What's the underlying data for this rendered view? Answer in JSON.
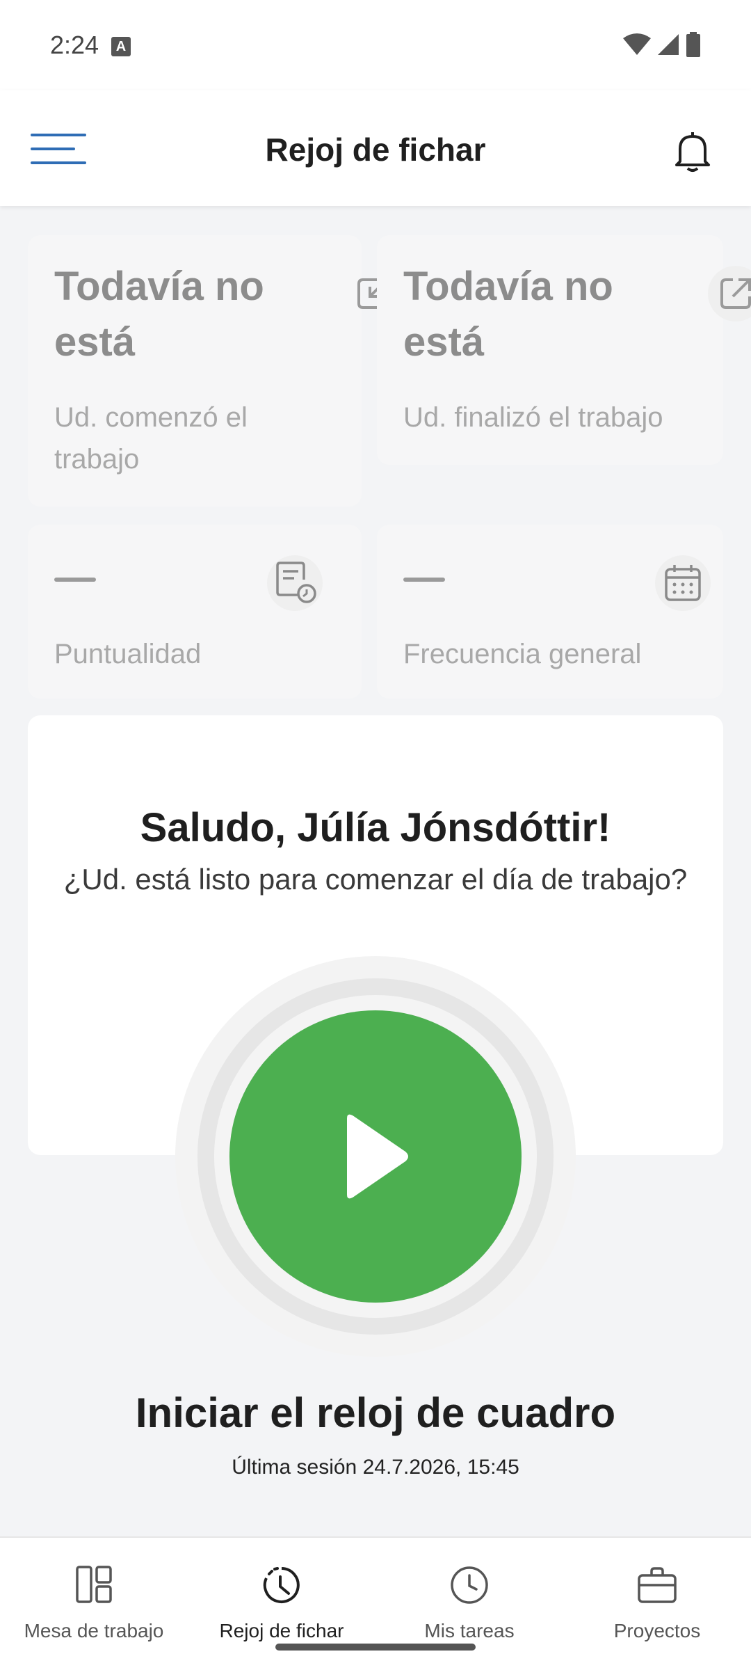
{
  "status_bar": {
    "time": "2:24"
  },
  "header": {
    "title": "Rejoj de fichar"
  },
  "cards": {
    "start": {
      "status": "Todavía no está",
      "label": "Ud. comenzó el trabajo"
    },
    "end": {
      "status": "Todavía no está",
      "label": "Ud. finalizó el trabajo"
    },
    "punctuality": {
      "value": "—",
      "label": "Puntualidad"
    },
    "frequency": {
      "value": "—",
      "label": "Frecuencia general"
    }
  },
  "greeting": {
    "title": "Saludo, Júlía Jónsdóttir!",
    "subtitle": "¿Ud. está listo para comenzar el día de trabajo?"
  },
  "clock": {
    "action_title": "Iniciar el reloj de cuadro",
    "last_session_label": "Última sesión",
    "last_session_value": "24.7.2026, 15:45"
  },
  "bottom_nav": [
    {
      "label": "Mesa de trabajo",
      "icon": "dashboard-icon"
    },
    {
      "label": "Rejoj de fichar",
      "icon": "clock-dashed-icon",
      "active": true
    },
    {
      "label": "Mis tareas",
      "icon": "clock-icon"
    },
    {
      "label": "Proyectos",
      "icon": "briefcase-icon"
    }
  ],
  "colors": {
    "accent": "#2f6db5",
    "play": "#4caf50"
  }
}
